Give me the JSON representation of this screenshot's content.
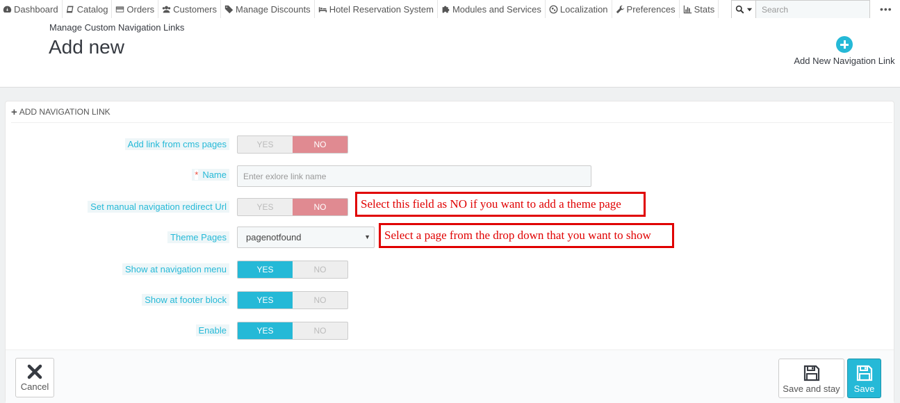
{
  "topnav": {
    "items": [
      {
        "label": "Dashboard",
        "icon": "dashboard-icon"
      },
      {
        "label": "Catalog",
        "icon": "book-icon"
      },
      {
        "label": "Orders",
        "icon": "credit-card-icon"
      },
      {
        "label": "Customers",
        "icon": "users-icon"
      },
      {
        "label": "Manage Discounts",
        "icon": "tag-icon"
      },
      {
        "label": "Hotel Reservation System",
        "icon": "bed-icon"
      },
      {
        "label": "Modules and Services",
        "icon": "puzzle-icon"
      },
      {
        "label": "Localization",
        "icon": "globe-icon"
      },
      {
        "label": "Preferences",
        "icon": "wrench-icon"
      },
      {
        "label": "Stats",
        "icon": "bar-chart-icon"
      }
    ],
    "search_placeholder": "Search",
    "more": "•••"
  },
  "header": {
    "breadcrumb": "Manage Custom Navigation Links",
    "title": "Add new",
    "toolbar_button": "Add New Navigation Link"
  },
  "panel": {
    "heading": "Add navigation link",
    "fields": {
      "cms_pages": {
        "label": "Add link from cms pages",
        "yes": "YES",
        "no": "NO",
        "value": "NO"
      },
      "name": {
        "label": "Name",
        "required_mark": "*",
        "placeholder": "Enter exlore link name"
      },
      "manual_url": {
        "label": "Set manual navigation redirect Url",
        "yes": "YES",
        "no": "NO",
        "value": "NO"
      },
      "theme_pages": {
        "label": "Theme Pages",
        "value": "pagenotfound",
        "caret": "▼"
      },
      "show_nav": {
        "label": "Show at navigation menu",
        "yes": "YES",
        "no": "NO",
        "value": "YES"
      },
      "show_footer": {
        "label": "Show at footer block",
        "yes": "YES",
        "no": "NO",
        "value": "YES"
      },
      "enable": {
        "label": "Enable",
        "yes": "YES",
        "no": "NO",
        "value": "YES"
      }
    },
    "annotations": {
      "manual_url_note": "Select this field as NO if you want to add a theme page",
      "theme_pages_note": "Select a page from the drop down that you want to show"
    },
    "footer": {
      "cancel": "Cancel",
      "save_and_stay": "Save and stay",
      "save": "Save"
    }
  },
  "colors": {
    "accent": "#25b9d7",
    "no_active": "#e08a91",
    "annotation": "#e00000",
    "required": "#e74c3c"
  }
}
